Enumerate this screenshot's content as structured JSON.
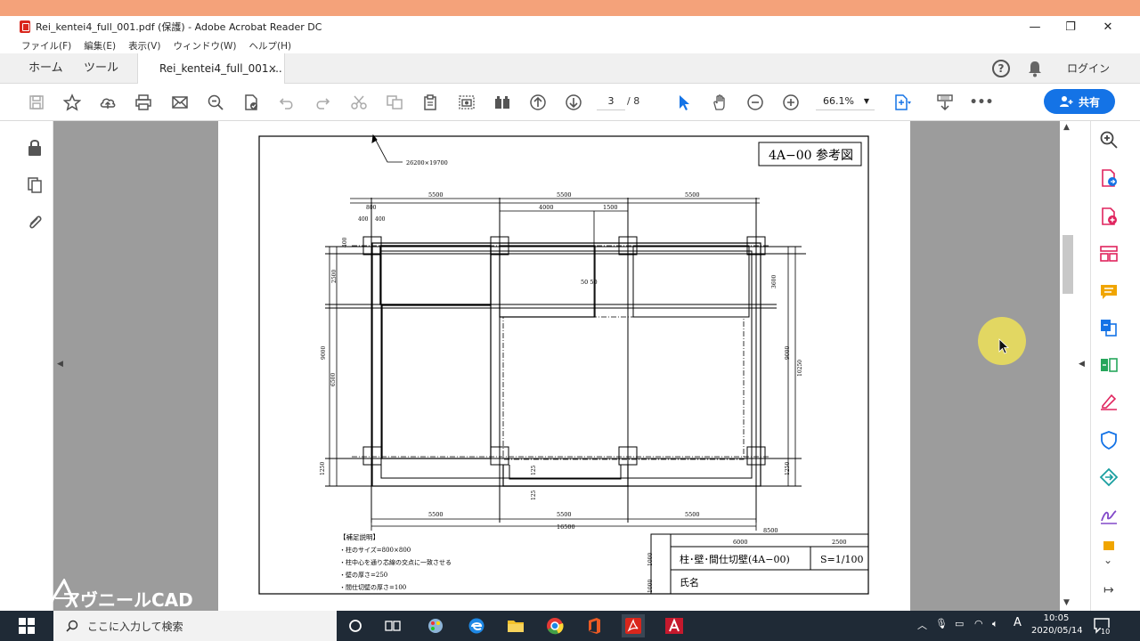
{
  "window": {
    "title": "Rei_kentei4_full_001.pdf (保護) - Adobe Acrobat Reader DC",
    "minimize": "—",
    "maximize": "❐",
    "close": "✕"
  },
  "menu": [
    "ファイル(F)",
    "編集(E)",
    "表示(V)",
    "ウィンドウ(W)",
    "ヘルプ(H)"
  ],
  "tabs": {
    "home": "ホーム",
    "tools": "ツール",
    "document": "Rei_kentei4_full_001....",
    "close": "×",
    "login": "ログイン",
    "help": "?"
  },
  "toolbar": {
    "page_current": "3",
    "page_total": "/ 8",
    "zoom": "66.1%",
    "share_label": "共有",
    "more": "•••"
  },
  "drawing": {
    "title_block": "4A−00 参考図",
    "sheet_size": "26200×19700",
    "dim_top": [
      "5500",
      "5500",
      "5500"
    ],
    "dim_upper": [
      "4000",
      "1500"
    ],
    "dim_small": [
      "800",
      "400",
      "400"
    ],
    "dim_center": "50 50",
    "dim_left": [
      "400",
      "2500",
      "9000",
      "6500",
      "1250"
    ],
    "dim_right": [
      "3600",
      "9000",
      "10250",
      "1250"
    ],
    "dim_bottom": [
      "5500",
      "5500",
      "5500"
    ],
    "dim_total": "16500",
    "dim_step": [
      "125",
      "125"
    ],
    "dim_8500": "8500",
    "notes_heading": "【補足説明】",
    "notes": [
      "・柱のサイズ=800×800",
      "・柱中心を通り芯線の交点に一致させる",
      "・壁の厚さ=250",
      "・間仕切壁の厚さ=100"
    ],
    "tb_cols": [
      "6000",
      "2500"
    ],
    "tb_rows": [
      "1000",
      "1000"
    ],
    "tb_title": "柱･壁･間仕切壁(4A−00)",
    "tb_scale": "S=1/100",
    "tb_name": "氏名"
  },
  "watermark": "アヴニールCAD",
  "taskbar": {
    "search_placeholder": "ここに入力して検索",
    "time": "10:05",
    "date": "2020/05/14",
    "ime": "A",
    "notif_count": "10"
  }
}
